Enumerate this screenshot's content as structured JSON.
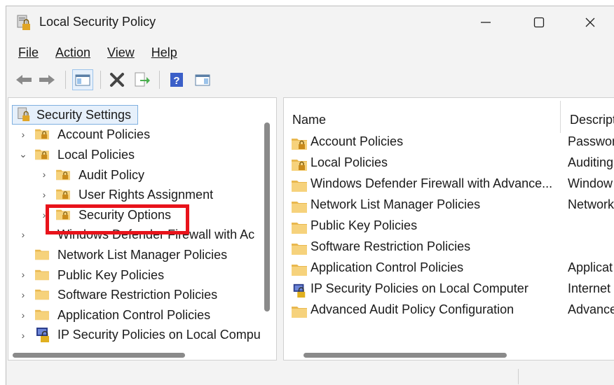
{
  "window": {
    "title": "Local Security Policy",
    "controls": {
      "minimize": "—",
      "maximize": "☐",
      "close": "✕"
    }
  },
  "menu": [
    {
      "label": "File"
    },
    {
      "label": "Action"
    },
    {
      "label": "View"
    },
    {
      "label": "Help"
    }
  ],
  "toolbar": {
    "buttons": [
      "back-icon",
      "forward-icon",
      "show-hide-console-tree-icon",
      "delete-icon",
      "export-list-icon",
      "help-icon",
      "show-hide-action-pane-icon"
    ]
  },
  "tree": {
    "root": "Security Settings",
    "items": [
      {
        "label": "Account Policies",
        "expanded": false
      },
      {
        "label": "Local Policies",
        "expanded": true
      },
      {
        "label": "Audit Policy",
        "expanded": false
      },
      {
        "label": "User Rights Assignment",
        "expanded": false
      },
      {
        "label": "Security Options",
        "expanded": false
      },
      {
        "label": "Windows Defender Firewall with Ac",
        "expanded": false
      },
      {
        "label": "Network List Manager Policies"
      },
      {
        "label": "Public Key Policies",
        "expanded": false
      },
      {
        "label": "Software Restriction Policies",
        "expanded": false
      },
      {
        "label": "Application Control Policies",
        "expanded": false
      },
      {
        "label": "IP Security Policies on Local Compu",
        "expanded": false
      }
    ]
  },
  "list": {
    "columns": [
      "Name",
      "Descript"
    ],
    "rows": [
      {
        "name": "Account Policies",
        "desc": "Passwor",
        "icon": "folder-lock-icon"
      },
      {
        "name": "Local Policies",
        "desc": "Auditing",
        "icon": "folder-lock-icon"
      },
      {
        "name": "Windows Defender Firewall with Advance...",
        "desc": "Window",
        "icon": "folder-icon"
      },
      {
        "name": "Network List Manager Policies",
        "desc": "Network",
        "icon": "folder-icon"
      },
      {
        "name": "Public Key Policies",
        "desc": "",
        "icon": "folder-icon"
      },
      {
        "name": "Software Restriction Policies",
        "desc": "",
        "icon": "folder-icon"
      },
      {
        "name": "Application Control Policies",
        "desc": "Applicat",
        "icon": "folder-icon"
      },
      {
        "name": "IP Security Policies on Local Computer",
        "desc": "Internet",
        "icon": "ip-security-icon"
      },
      {
        "name": "Advanced Audit Policy Configuration",
        "desc": "Advance",
        "icon": "folder-icon"
      }
    ]
  },
  "colors": {
    "highlight": "#e8131b",
    "folder": "#f2c96a",
    "selection": "#e6f0fb"
  }
}
